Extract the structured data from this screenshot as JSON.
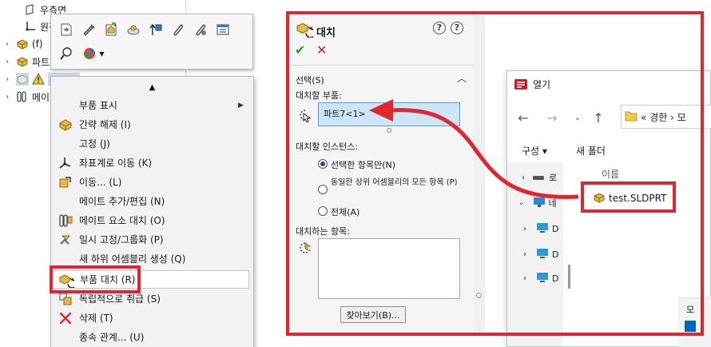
{
  "feature_tree": {
    "rows": [
      {
        "label": "우측면"
      },
      {
        "label": "원점"
      },
      {
        "label": "(f)"
      },
      {
        "label": "파트"
      },
      {
        "label": ""
      },
      {
        "label": "메이트"
      }
    ]
  },
  "context_toolbar": {
    "icons": [
      "open-part-icon",
      "edit-part-icon",
      "hide-show-icon",
      "appearance-icon",
      "move-component-icon",
      "mate-icon",
      "suppress-icon",
      "properties-icon",
      "zoom-icon",
      "appearance-dropdown-icon"
    ]
  },
  "context_menu": {
    "items": [
      {
        "label": "부품 표시",
        "submenu": true
      },
      {
        "label": "간략 해제 (I)",
        "submenu": false
      },
      {
        "label": "고정 (J)",
        "submenu": false
      },
      {
        "label": "좌표계로 이동 (K)",
        "submenu": false
      },
      {
        "label": "이동... (L)",
        "submenu": false
      },
      {
        "label": "메이트 추가/편집 (N)",
        "submenu": false
      },
      {
        "label": "메이트 요소 대치 (O)",
        "submenu": false
      },
      {
        "label": "일시 고정/그룹화 (P)",
        "submenu": false
      },
      {
        "label": "새 하위 어셈블리 생성 (Q)",
        "submenu": false
      },
      {
        "label": "부품 대치 (R)",
        "submenu": false,
        "highlighted": true
      },
      {
        "label": "독립적으로 취급 (S)",
        "submenu": false
      },
      {
        "label": "삭제 (T)",
        "submenu": false
      },
      {
        "label": "종속 관계... (U)",
        "submenu": false
      }
    ]
  },
  "property_manager": {
    "title": "대치",
    "help1": "?",
    "help2": "?",
    "ok_glyph": "✔",
    "cancel_glyph": "✕",
    "section_label": "선택(S)",
    "replace_label": "대치할 부품:",
    "replace_value": "파트7<1>",
    "instances_label": "대치할 인스턴스:",
    "radio_options": [
      {
        "label": "선택한 항목만(N)",
        "selected": true
      },
      {
        "label": "동일한 상위 어셈블리의 모든 항목 (P)",
        "selected": false
      },
      {
        "label": "전체(A)",
        "selected": false
      }
    ],
    "with_label": "대치하는 항목:",
    "browse_button": "찾아보기(B)..."
  },
  "open_dialog": {
    "title": "열기",
    "address": "«  경한  ›  모",
    "organize": "구성 ▾",
    "new_folder": "새 폴더",
    "column_name": "이름",
    "side_items": [
      {
        "label": "로",
        "icon": "drive-icon"
      },
      {
        "label": "네",
        "icon": "network-icon"
      },
      {
        "label": "D",
        "icon": "monitor-icon"
      },
      {
        "label": "D",
        "icon": "monitor-icon"
      },
      {
        "label": "D",
        "icon": "monitor-icon"
      }
    ],
    "file": {
      "name": "test.SLDPRT"
    },
    "bottom_hint": "모"
  },
  "colors": {
    "annotation_red": "#e0262e",
    "ok_green": "#2a9d2a",
    "cancel_red": "#d21f1f",
    "selection_blue": "#cde6f7"
  }
}
